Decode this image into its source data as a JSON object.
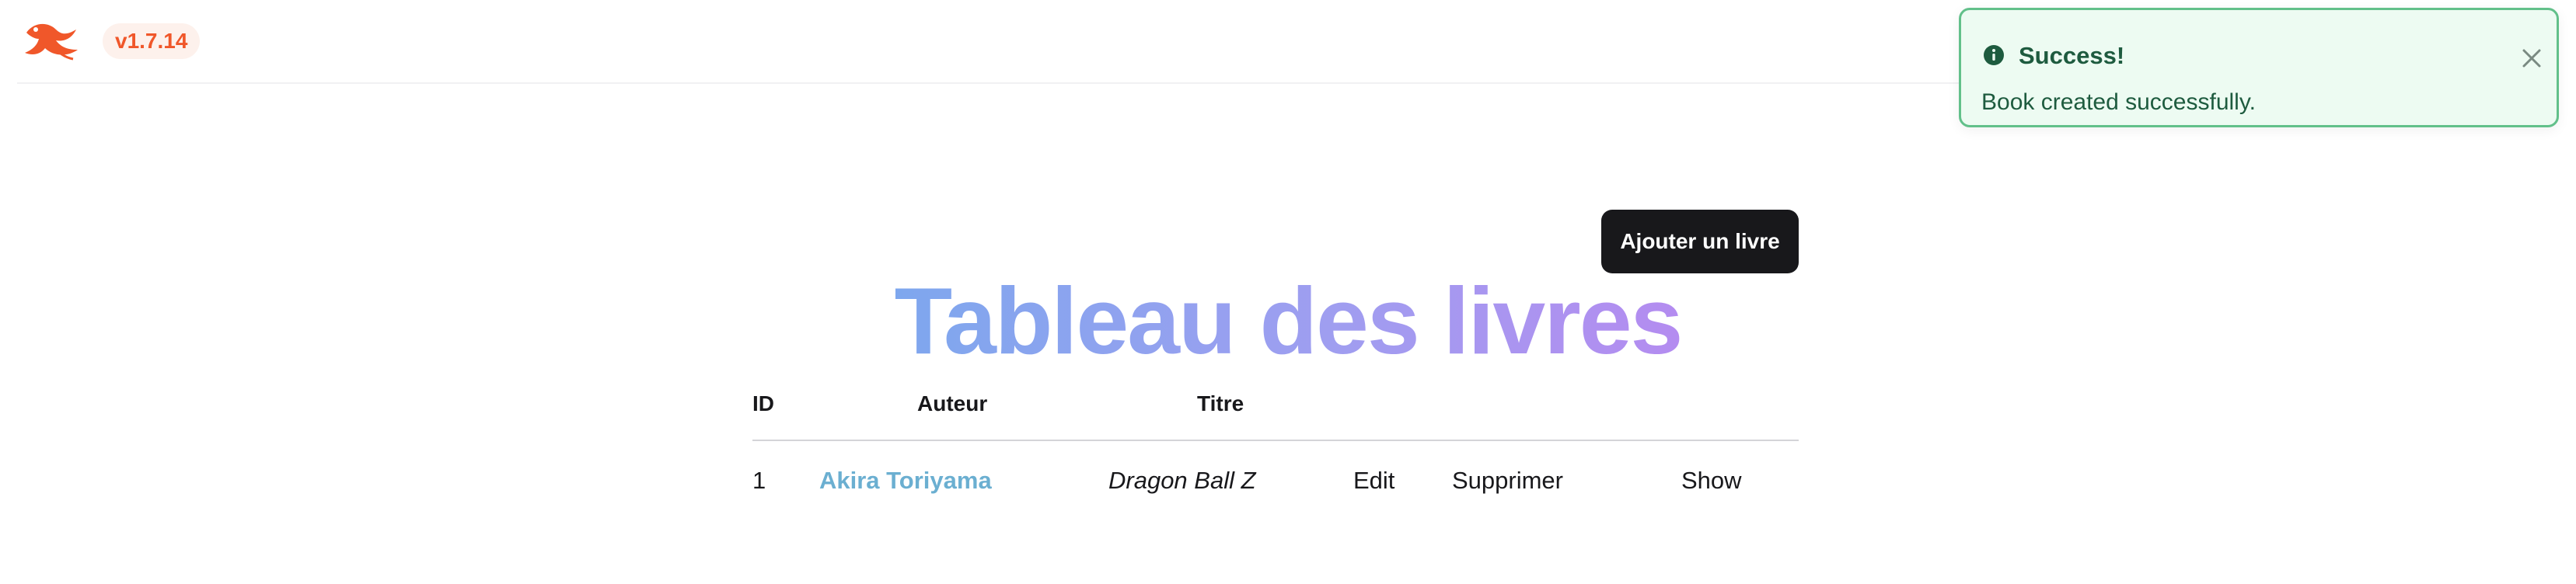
{
  "header": {
    "version": "v1.7.14"
  },
  "flash": {
    "title": "Success!",
    "message": "Book created successfully.",
    "color": "#62c08a"
  },
  "main": {
    "add_button_label": "Ajouter un livre",
    "title": "Tableau des livres",
    "title_gradient": [
      "#7ea7ee",
      "#9f9ef0",
      "#b48cf0"
    ]
  },
  "table": {
    "columns": [
      "ID",
      "Auteur",
      "Titre"
    ],
    "rows": [
      {
        "id": "1",
        "author": "Akira Toriyama",
        "title": "Dragon Ball Z",
        "actions": [
          "Edit",
          "Supprimer",
          "Show"
        ]
      }
    ]
  }
}
